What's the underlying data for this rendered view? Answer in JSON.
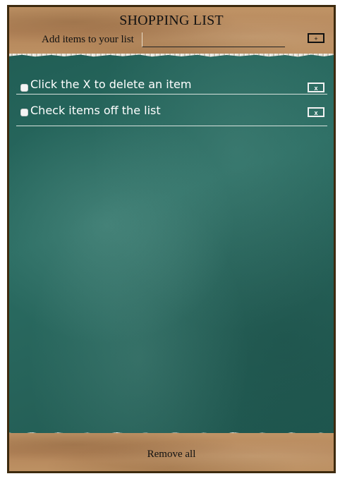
{
  "header": {
    "title": "SHOPPING LIST",
    "add_label": "Add items to your list",
    "input_value": "",
    "add_button_label": "+"
  },
  "items": [
    {
      "text": "Click the X to delete an item",
      "checked": false,
      "delete_label": "x"
    },
    {
      "text": "Check items off the list",
      "checked": false,
      "delete_label": "x"
    }
  ],
  "footer": {
    "remove_all_label": "Remove all"
  },
  "colors": {
    "frame": "#3d2a0e",
    "paper": "#b98d5f",
    "chalkboard": "#266259",
    "item_text": "#ffffff"
  }
}
